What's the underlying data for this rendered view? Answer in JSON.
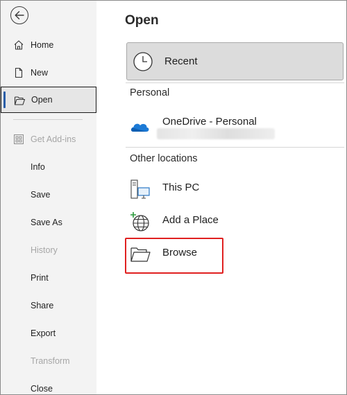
{
  "sidebar": {
    "back_icon": "arrow-left-circle-icon",
    "items": [
      {
        "label": "Home",
        "icon": "home-icon",
        "state": "normal"
      },
      {
        "label": "New",
        "icon": "new-document-icon",
        "state": "normal"
      },
      {
        "label": "Open",
        "icon": "open-folder-icon",
        "state": "selected"
      },
      {
        "label": "Get Add-ins",
        "icon": "grid-icon",
        "state": "disabled"
      },
      {
        "label": "Info",
        "state": "normal"
      },
      {
        "label": "Save",
        "state": "normal"
      },
      {
        "label": "Save As",
        "state": "normal"
      },
      {
        "label": "History",
        "state": "disabled"
      },
      {
        "label": "Print",
        "state": "normal"
      },
      {
        "label": "Share",
        "state": "normal"
      },
      {
        "label": "Export",
        "state": "normal"
      },
      {
        "label": "Transform",
        "state": "disabled"
      },
      {
        "label": "Close",
        "state": "normal"
      }
    ]
  },
  "main": {
    "title": "Open",
    "recent": {
      "label": "Recent",
      "icon": "clock-icon"
    },
    "personal_section": "Personal",
    "onedrive": {
      "label": "OneDrive - Personal",
      "icon": "onedrive-cloud-icon"
    },
    "other_section": "Other locations",
    "locations": [
      {
        "label": "This PC",
        "icon": "computer-icon"
      },
      {
        "label": "Add a Place",
        "icon": "globe-add-icon"
      },
      {
        "label": "Browse",
        "icon": "folder-icon",
        "highlighted": true
      }
    ]
  },
  "colors": {
    "sidebar_bg": "#f3f3f3",
    "accent": "#2a5ea8",
    "highlight": "#e02020",
    "recent_bg": "#dcdcdc",
    "onedrive": "#1c7ad6"
  }
}
